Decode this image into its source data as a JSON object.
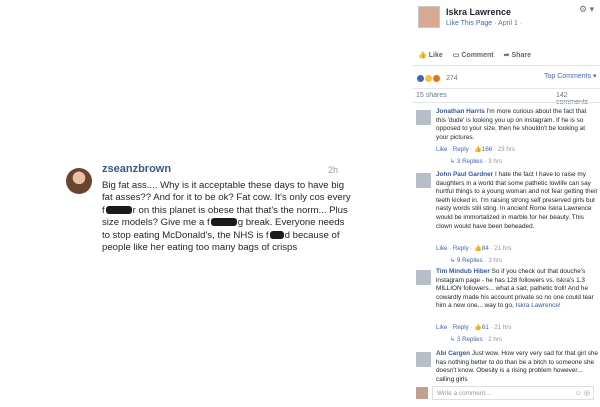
{
  "instagram": {
    "username": "zseanzbrown",
    "time": "2h",
    "line1": "Big fat ass.... Why is it acceptable these days to have big fat asses?? And for it to be ok? Fat cow. It's only cos every f",
    "line2": "r on this planet is obese that that's the norm... Plus size models? Give me a f",
    "line3": "g break. Everyone needs to stop eating McDonald's, the NHS is f",
    "line4": "d because of people like her eating too many bags of crisps"
  },
  "facebook": {
    "page_name": "Iskra Lawrence",
    "like_this_page": "Like This Page",
    "date": "· April 1 ·",
    "actions": {
      "like": "Like",
      "comment": "Comment",
      "share": "Share"
    },
    "reactions_count": "274",
    "top_comments": "Top Comments ▾",
    "shares": "15 shares",
    "comments_count": "142 comments",
    "comments": [
      {
        "name": "Jonathan Harris",
        "text": "I'm more curious about the fact that this 'dude' is looking you up on instagram. If he is so opposed to your size, then he shouldn't be looking at your pictures.",
        "like": "Like",
        "reply": "Reply",
        "likes": "166",
        "time": "23 hrs",
        "replies": "3 Replies",
        "replies_time": "3 hrs"
      },
      {
        "name": "John Paul Gardner",
        "text": "I hate the fact I have to raise my daughters in a world that some pathetic lowlife can say hurtful things to a young woman and not fear getting their teeth kicked in. I'm raising strong self preserved girls but nasty words still sting. In ancient Rome Iskra Lawrence would be immortalized in marble for her beauty. This clown would have been beheaded.",
        "like": "Like",
        "reply": "Reply",
        "likes": "84",
        "time": "21 hrs",
        "replies": "9 Replies",
        "replies_time": "3 hrs"
      },
      {
        "name": "Tim Mindub Hiber",
        "text": "So if you check out that douche's instagram page - he has 128 followers vs. Iskra's 1.3 MILLION followers... what a sad, pathetic troll! And he cowardly made his account private so no one could tear him a new one... way to go, ",
        "mention": "Iskra Lawrence!",
        "like": "Like",
        "reply": "Reply",
        "likes": "61",
        "time": "21 hrs",
        "replies": "3 Replies",
        "replies_time": "2 hrs"
      },
      {
        "name": "Abi Cargen",
        "text": "Just wow. How very very sad for that girl she has nothing better to do than be a bitch to someone she doesn't know. Obesity is a rising problem however... calling girls"
      }
    ],
    "write_placeholder": "Write a comment...",
    "write_icons": "☺ ◎"
  },
  "icons": [
    "gear-icon",
    "like-icon",
    "comment-icon",
    "share-icon",
    "like-reaction-icon",
    "haha-reaction-icon",
    "angry-reaction-icon",
    "emoji-icon",
    "camera-icon"
  ],
  "colors": {
    "fb_link": "#4267b2",
    "fb_name": "#385898",
    "insta_user": "#3b5a82",
    "redaction": "#1a1a1a"
  }
}
